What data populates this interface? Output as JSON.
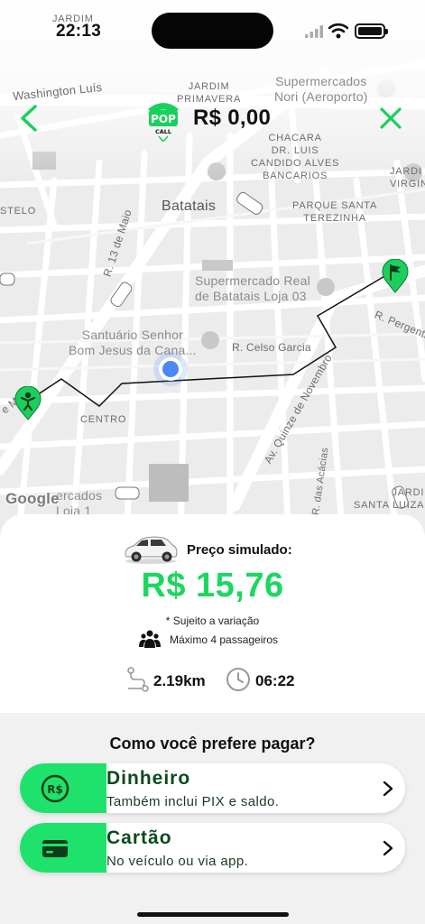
{
  "status_bar": {
    "time": "22:13"
  },
  "top_bar": {
    "logo_text": "POP",
    "logo_sub": "CALL",
    "fare": "R$ 0,00"
  },
  "map": {
    "labels": {
      "jardim_top": "JARDIM",
      "washington": "Washington Luís",
      "jardim_primavera": "JARDIM\nPRIMAVERA",
      "supermercados_nori": "Supermercados\nNori (Aeroporto)",
      "chacara": "CHACARA\nDR. LUIS\nCANDIDO ALVES\nBANCARIOS",
      "jardim_virgin": "JARDI\nVIRGIN",
      "estelo": "STELO",
      "batatais": "Batatais",
      "parque": "PARQUE SANTA\nTEREZINHA",
      "r13": "R. 13 de Maio",
      "supermercado_real": "Supermercado Real\nde Batatais Loja 03",
      "santuario": "Santuário Senhor\nBom Jesus da Cana...",
      "celso": "R. Celso Garcia",
      "pergentino": "R. Pergentin",
      "centro": "CENTRO",
      "quinze": "Av. Quinze de Novembro",
      "acacias": "R. das Acácias",
      "jardim_santa": "JARDI\nSANTA LUIZA",
      "mercados_loja": "ercados\nLoja 1",
      "ma": "e Ma"
    },
    "google": "Google"
  },
  "quote": {
    "caption": "Preço simulado:",
    "price": "R$ 15,76",
    "variation": "* Sujeito a variação",
    "passengers": "Máximo 4 passageiros",
    "distance": "2.19km",
    "duration": "06:22"
  },
  "payment": {
    "title": "Como você prefere pagar?",
    "options": [
      {
        "name": "Dinheiro",
        "description": "Também inclui PIX e saldo.",
        "icon": "cash-icon"
      },
      {
        "name": "Cartão",
        "description": "No veículo ou via app.",
        "icon": "card-icon"
      }
    ]
  },
  "colors": {
    "accent": "#1ee26b",
    "price": "#1bd760",
    "route": "#111111",
    "user_location": "#4a88f5"
  }
}
